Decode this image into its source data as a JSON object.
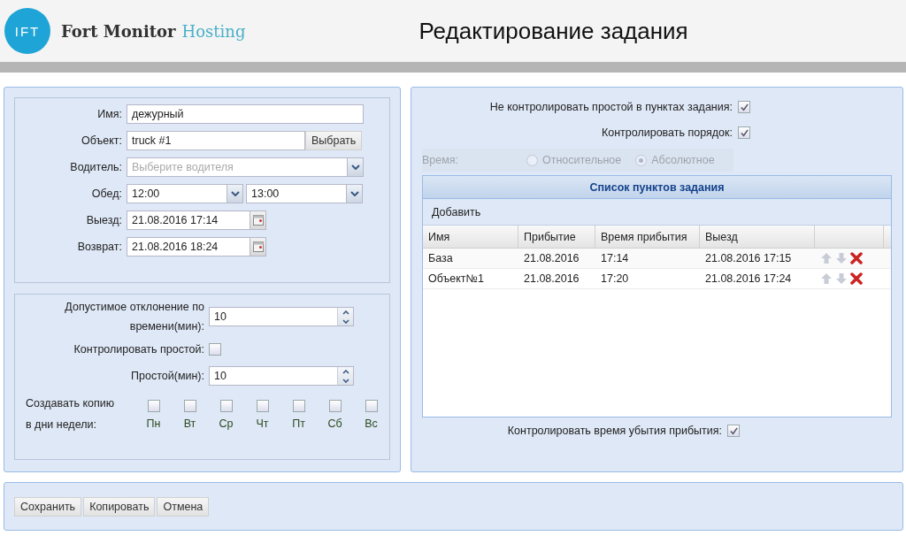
{
  "header": {
    "logo_mark": "IFT",
    "brand": "Fort Monitor",
    "brand_suffix": "Hosting",
    "title": "Редактирование задания"
  },
  "main_form": {
    "fields": [
      {
        "kind": "text",
        "label": "Имя:",
        "value": "дежурный"
      },
      {
        "kind": "picker",
        "label": "Объект:",
        "value": "truck #1",
        "button": "Выбрать"
      },
      {
        "kind": "select",
        "label": "Водитель:",
        "placeholder": "Выберите водителя"
      },
      {
        "kind": "select_pair",
        "label": "Обед:",
        "values": [
          "12:00",
          "13:00"
        ]
      },
      {
        "kind": "date",
        "label": "Выезд:",
        "value": "21.08.2016 17:14"
      },
      {
        "kind": "date",
        "label": "Возврат:",
        "value": "21.08.2016 18:24"
      }
    ]
  },
  "options_form": {
    "deviation": {
      "label": "Допустимое отклонение по времени(мин):",
      "value": "10"
    },
    "idle_check": {
      "label": "Контролировать простой:",
      "checked": false
    },
    "idle": {
      "label": "Простой(мин):",
      "value": "10"
    },
    "weekdays": {
      "label": "Создавать копию в дни недели:",
      "days": [
        {
          "label": "Пн",
          "checked": false
        },
        {
          "label": "Вт",
          "checked": false
        },
        {
          "label": "Ср",
          "checked": false
        },
        {
          "label": "Чт",
          "checked": false
        },
        {
          "label": "Пт",
          "checked": false
        },
        {
          "label": "Сб",
          "checked": false
        },
        {
          "label": "Вс",
          "checked": false
        }
      ]
    }
  },
  "settings": {
    "checks": [
      {
        "label": "Не контролировать простой в пунктах задания:",
        "checked": true
      },
      {
        "label": "Контролировать порядок:",
        "checked": true
      }
    ],
    "time_mode": {
      "label": "Время:",
      "disabled": true,
      "options": [
        {
          "label": "Относительное",
          "selected": false
        },
        {
          "label": "Абсолютное",
          "selected": true
        }
      ]
    }
  },
  "points": {
    "title": "Список пунктов задания",
    "add": "Добавить",
    "columns": [
      "Имя",
      "Прибытие",
      "Время прибытия",
      "Выезд"
    ],
    "rows": [
      {
        "cells": [
          "База",
          "21.08.2016",
          "17:14",
          "21.08.2016 17:15"
        ]
      },
      {
        "cells": [
          "Объект№1",
          "21.08.2016",
          "17:20",
          "21.08.2016 17:24"
        ]
      }
    ]
  },
  "arrival_check": {
    "label": "Контролировать время убытия прибытия:",
    "checked": true
  },
  "buttons": [
    "Сохранить",
    "Копировать",
    "Отмена"
  ]
}
